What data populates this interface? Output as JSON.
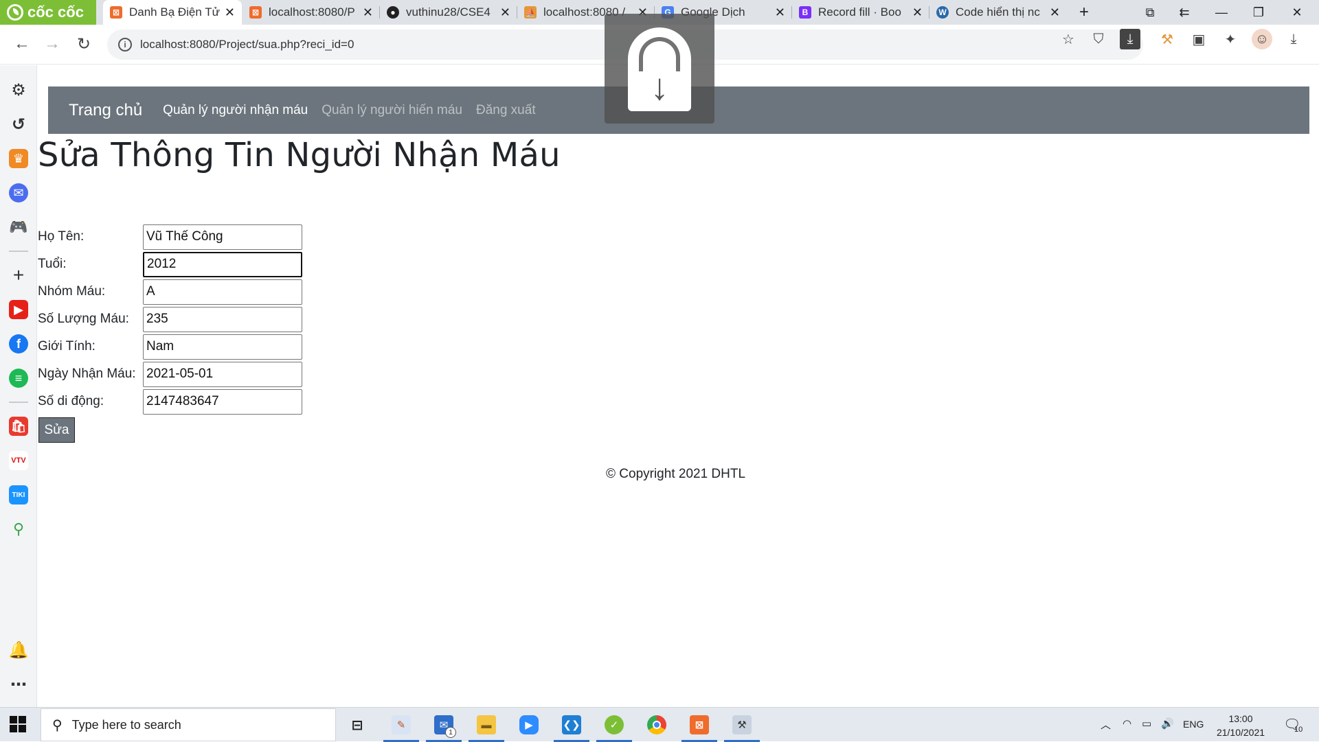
{
  "browser": {
    "brand": "cốc cốc",
    "tabs": [
      {
        "title": "Danh Bạ Điện Tử",
        "favicon_color": "#ef6c2d",
        "active": true
      },
      {
        "title": "localhost:8080/P",
        "favicon_color": "#ef6c2d"
      },
      {
        "title": "vuthinu28/CSE4",
        "favicon_color": "#222222"
      },
      {
        "title": "localhost:8080 /",
        "favicon_color": "#e5973a"
      },
      {
        "title": "Google Dịch",
        "favicon_color": "#4a80f0"
      },
      {
        "title": "Record fill · Boo",
        "favicon_color": "#7b2ff7"
      },
      {
        "title": "Code hiển thị nc",
        "favicon_color": "#2a6aa8"
      }
    ],
    "url": "localhost:8080/Project/sua.php?reci_id=0"
  },
  "navbar": {
    "brand": "Trang chủ",
    "links": [
      {
        "label": "Quản lý người nhận máu",
        "active": true
      },
      {
        "label": "Quản lý người hiến máu",
        "active": false
      },
      {
        "label": "Đăng xuất",
        "active": false
      }
    ],
    "color": "#6c757d"
  },
  "page": {
    "title": "Sửa Thông Tin Người Nhận Máu",
    "fields": [
      {
        "label": "Họ Tên:",
        "value": "Vũ Thế Công"
      },
      {
        "label": "Tuổi:",
        "value": "2012",
        "focused": true
      },
      {
        "label": "Nhóm Máu:",
        "value": "A"
      },
      {
        "label": "Số Lượng Máu:",
        "value": "235"
      },
      {
        "label": "Giới Tính:",
        "value": "Nam"
      },
      {
        "label": "Ngày Nhận Máu:",
        "value": "2021-05-01"
      },
      {
        "label": "Số di động:",
        "value": "2147483647"
      }
    ],
    "submit_label": "Sửa",
    "footer": "© Copyright 2021 DHTL"
  },
  "taskbar": {
    "search_placeholder": "Type here to search",
    "language": "ENG",
    "time": "13:00",
    "date": "21/10/2021",
    "mail_badge": "1",
    "notification_count": "10"
  }
}
